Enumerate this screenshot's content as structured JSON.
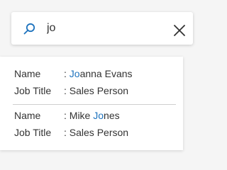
{
  "search": {
    "value": "jo",
    "placeholder": ""
  },
  "results": [
    {
      "name_label": "Name",
      "separator": ": ",
      "name_pre": "",
      "name_match": "Jo",
      "name_post": "anna Evans",
      "title_label": "Job Title",
      "title_value": ": Sales Person"
    },
    {
      "name_label": "Name",
      "separator": ": ",
      "name_pre": "Mike ",
      "name_match": "Jo",
      "name_post": "nes",
      "title_label": "Job Title",
      "title_value": ": Sales Person"
    }
  ],
  "colors": {
    "highlight": "#1e73be",
    "icon": "#1e73be"
  },
  "icons": {
    "search": "search-icon",
    "clear": "close-icon"
  }
}
